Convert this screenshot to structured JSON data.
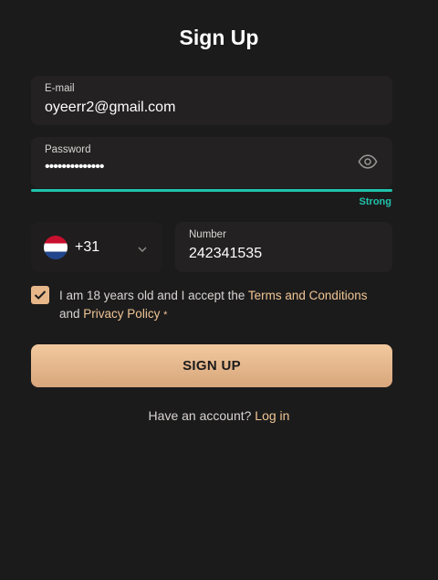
{
  "page": {
    "title": "Sign Up"
  },
  "form": {
    "email": {
      "label": "E-mail",
      "value": "oyeerr2@gmail.com"
    },
    "password": {
      "label": "Password",
      "value": "••••••••••••••",
      "toggle_icon": "eye-icon"
    },
    "strength": {
      "label": "Strong",
      "color": "#1fc3ab"
    },
    "phone": {
      "country_flag": "netherlands-flag-icon",
      "dial_code": "+31",
      "number_label": "Number",
      "number_value": "242341535"
    },
    "consent": {
      "checked": true,
      "text_prefix": "I am 18 years old and I accept the",
      "terms_link": "Terms and Conditions",
      "and": "and",
      "privacy_link": "Privacy Policy",
      "required_mark": "*"
    },
    "submit_label": "SIGN UP"
  },
  "footer": {
    "prompt": "Have an account?",
    "login_link": "Log in"
  },
  "colors": {
    "background": "#1c1b1c",
    "accent": "#efc594",
    "button": "#e7b78a",
    "strength": "#1fc3ab"
  }
}
